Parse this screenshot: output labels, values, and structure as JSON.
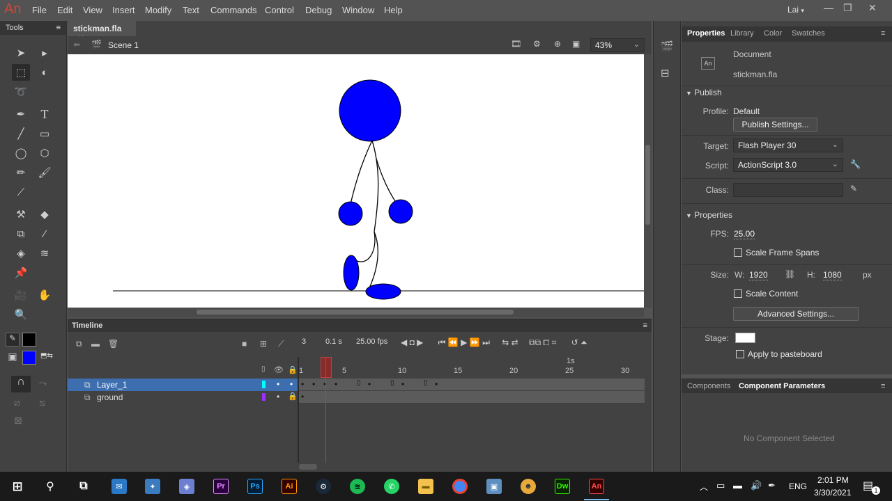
{
  "app": {
    "logo": "An",
    "user": "Lai"
  },
  "menu": [
    "File",
    "Edit",
    "View",
    "Insert",
    "Modify",
    "Text",
    "Commands",
    "Control",
    "Debug",
    "Window",
    "Help"
  ],
  "tools_panel": {
    "title": "Tools"
  },
  "document": {
    "tab": "stickman.fla",
    "scene": "Scene 1",
    "zoom": "43%"
  },
  "timeline": {
    "title": "Timeline",
    "current_frame": "3",
    "elapsed": "0.1 s",
    "fps_display": "25.00 fps",
    "ruler": [
      "1",
      "5",
      "10",
      "15",
      "20",
      "25",
      "30"
    ],
    "second_marker": "1s",
    "layers": [
      {
        "name": "Layer_1",
        "color": "#00ffff",
        "selected": true
      },
      {
        "name": "ground",
        "color": "#9b30ff",
        "selected": false
      }
    ]
  },
  "properties": {
    "tabs": [
      "Properties",
      "Library",
      "Color",
      "Swatches"
    ],
    "doc_type": "Document",
    "doc_name": "stickman.fla",
    "publish_section": "Publish",
    "profile_label": "Profile:",
    "profile_value": "Default",
    "publish_settings": "Publish Settings...",
    "target_label": "Target:",
    "target_value": "Flash Player 30",
    "script_label": "Script:",
    "script_value": "ActionScript 3.0",
    "class_label": "Class:",
    "properties_section": "Properties",
    "fps_label": "FPS:",
    "fps_value": "25.00",
    "scale_frame_spans": "Scale Frame Spans",
    "size_label": "Size:",
    "w_label": "W:",
    "w_value": "1920",
    "h_label": "H:",
    "h_value": "1080",
    "unit": "px",
    "scale_content": "Scale Content",
    "advanced_settings": "Advanced Settings...",
    "stage_label": "Stage:",
    "stage_color": "#ffffff",
    "apply_pasteboard": "Apply to pasteboard"
  },
  "components_panel": {
    "tabs": [
      "Components",
      "Component Parameters"
    ],
    "empty": "No Component Selected"
  },
  "taskbar": {
    "lang": "ENG",
    "time": "2:01 PM",
    "date": "3/30/2021",
    "notifications": "1",
    "apps": [
      "Outlook",
      "Game",
      "Dev",
      "Pr",
      "Ps",
      "Ai",
      "Steam",
      "Spotify",
      "WhatsApp",
      "Files",
      "Chrome",
      "Remote",
      "Mascot",
      "Dw",
      "An"
    ]
  },
  "colors": {
    "accent": "#3d6fb0",
    "stickman": "#0000ff"
  }
}
